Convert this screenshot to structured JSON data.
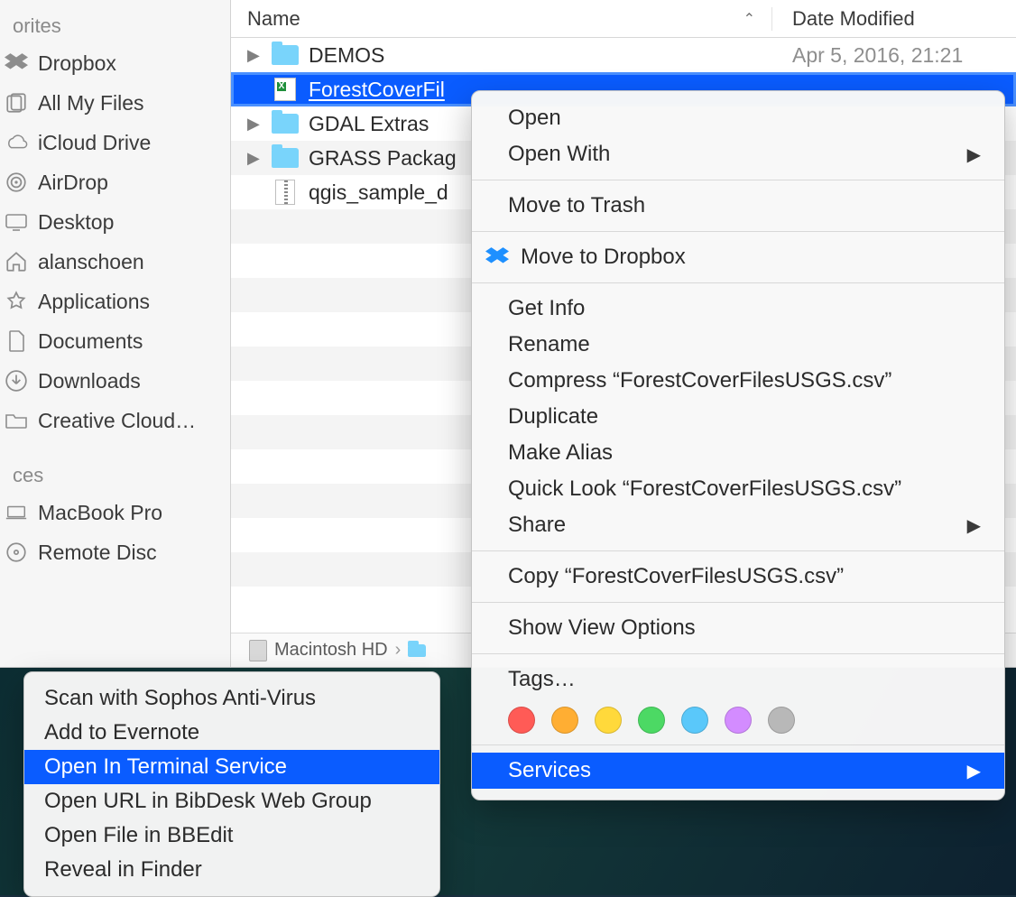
{
  "sidebar": {
    "section_favorites": "orites",
    "section_devices": "ces",
    "favorites": [
      {
        "label": "Dropbox",
        "icon": "dropbox"
      },
      {
        "label": "All My Files",
        "icon": "all-files"
      },
      {
        "label": "iCloud Drive",
        "icon": "icloud"
      },
      {
        "label": "AirDrop",
        "icon": "airdrop"
      },
      {
        "label": "Desktop",
        "icon": "desktop"
      },
      {
        "label": "alanschoen",
        "icon": "home"
      },
      {
        "label": "Applications",
        "icon": "apps"
      },
      {
        "label": "Documents",
        "icon": "docs"
      },
      {
        "label": "Downloads",
        "icon": "downloads"
      },
      {
        "label": "Creative Cloud…",
        "icon": "folder"
      }
    ],
    "devices": [
      {
        "label": "MacBook Pro",
        "icon": "laptop"
      },
      {
        "label": "Remote Disc",
        "icon": "disc"
      }
    ]
  },
  "columns": {
    "name": "Name",
    "date": "Date Modified"
  },
  "rows": [
    {
      "kind": "folder",
      "name": "DEMOS",
      "date": "Apr 5, 2016, 21:21",
      "disclosure": true,
      "selected": false
    },
    {
      "kind": "xls",
      "name": "ForestCoverFil",
      "date": "",
      "disclosure": false,
      "selected": true
    },
    {
      "kind": "folder",
      "name": "GDAL Extras",
      "date": "",
      "disclosure": true,
      "selected": false
    },
    {
      "kind": "folder",
      "name": "GRASS Packag",
      "date": "",
      "disclosure": true,
      "selected": false
    },
    {
      "kind": "zip",
      "name": "qgis_sample_d",
      "date": "",
      "disclosure": false,
      "selected": false
    }
  ],
  "pathbar": {
    "disk": "Macintosh HD"
  },
  "context_menu": {
    "open": "Open",
    "open_with": "Open With",
    "trash": "Move to Trash",
    "move_dropbox": "Move to Dropbox",
    "get_info": "Get Info",
    "rename": "Rename",
    "compress": "Compress “ForestCoverFilesUSGS.csv”",
    "duplicate": "Duplicate",
    "make_alias": "Make Alias",
    "quick_look": "Quick Look “ForestCoverFilesUSGS.csv”",
    "share": "Share",
    "copy": "Copy “ForestCoverFilesUSGS.csv”",
    "view_options": "Show View Options",
    "tags": "Tags…",
    "services": "Services",
    "tag_colors": [
      "#ff5b56",
      "#ffae33",
      "#ffd93b",
      "#4cd964",
      "#5ac8fa",
      "#d38cff",
      "#b8b8b8"
    ]
  },
  "services_submenu": [
    {
      "label": "Scan with Sophos Anti-Virus",
      "selected": false
    },
    {
      "label": "Add to Evernote",
      "selected": false
    },
    {
      "label": "Open In Terminal Service",
      "selected": true
    },
    {
      "label": "Open URL in BibDesk Web Group",
      "selected": false
    },
    {
      "label": "Open File in BBEdit",
      "selected": false
    },
    {
      "label": "Reveal in Finder",
      "selected": false
    }
  ]
}
